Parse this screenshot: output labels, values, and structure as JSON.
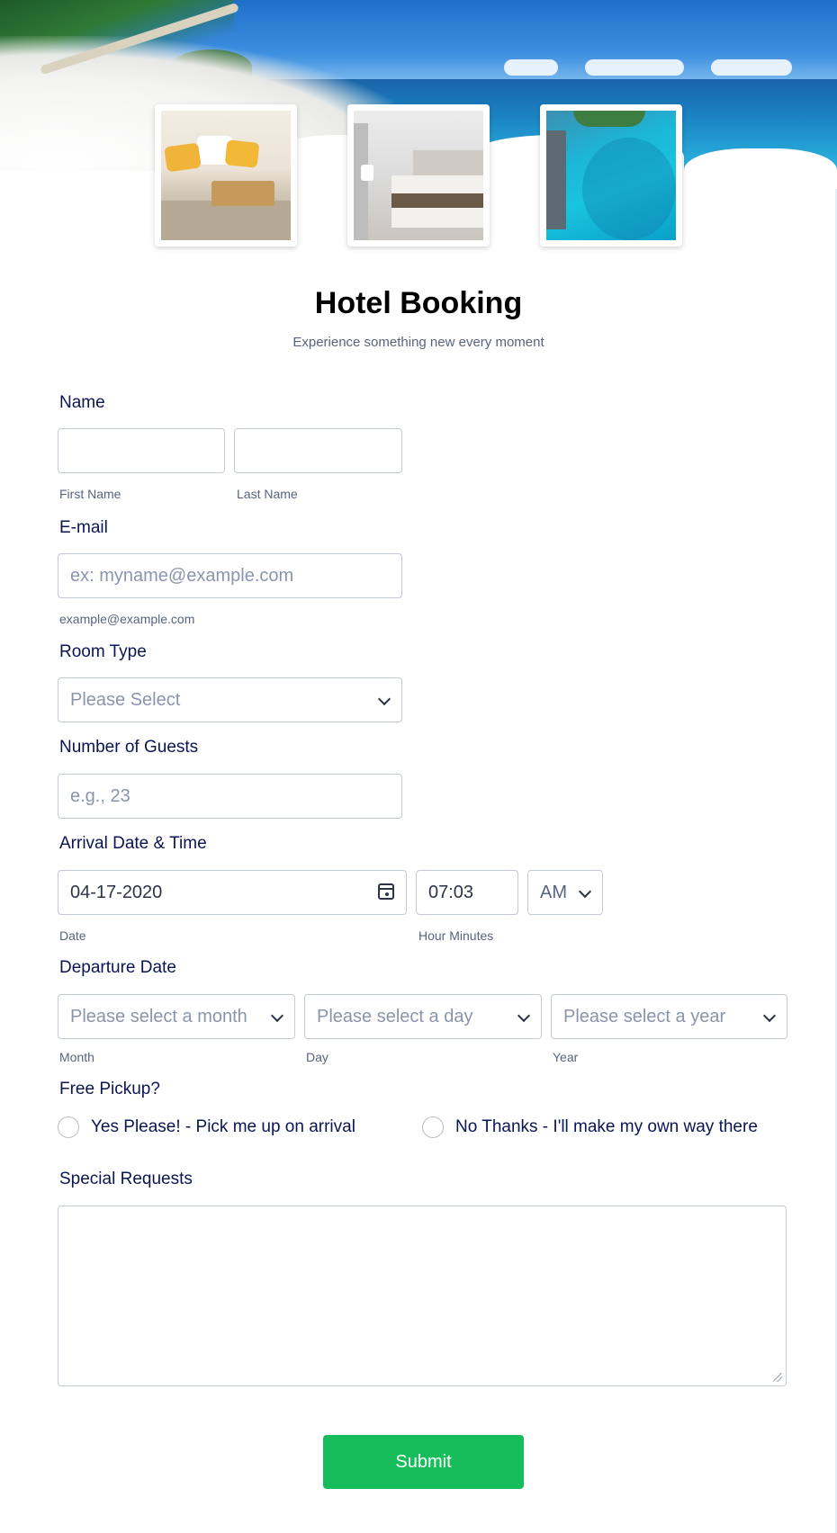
{
  "header": {
    "title": "Hotel Booking",
    "subtitle": "Experience something new every moment",
    "photos": [
      "bedroom-photo",
      "hotel-room-photo",
      "beach-resort-photo"
    ]
  },
  "form": {
    "name": {
      "label": "Name",
      "first_sublabel": "First Name",
      "last_sublabel": "Last Name"
    },
    "email": {
      "label": "E-mail",
      "placeholder": "ex: myname@example.com",
      "sublabel": "example@example.com"
    },
    "room_type": {
      "label": "Room Type",
      "selected": "Please Select"
    },
    "guests": {
      "label": "Number of Guests",
      "placeholder": "e.g., 23"
    },
    "arrival": {
      "label": "Arrival Date & Time",
      "date_value": "04-17-2020",
      "time_value": "07:03",
      "ampm_value": "AM",
      "date_sublabel": "Date",
      "time_sublabel": "Hour Minutes"
    },
    "departure": {
      "label": "Departure Date",
      "month_selected": "Please select a month",
      "day_selected": "Please select a day",
      "year_selected": "Please select a year",
      "month_sublabel": "Month",
      "day_sublabel": "Day",
      "year_sublabel": "Year"
    },
    "pickup": {
      "label": "Free Pickup?",
      "option_yes": "Yes Please! - Pick me up on arrival",
      "option_no": "No Thanks - I'll make my own way there"
    },
    "requests": {
      "label": "Special Requests"
    },
    "submit_label": "Submit"
  },
  "colors": {
    "accent": "#18bd5b",
    "text": "#0a1551",
    "muted": "#57647e",
    "border": "#c3cad8"
  }
}
